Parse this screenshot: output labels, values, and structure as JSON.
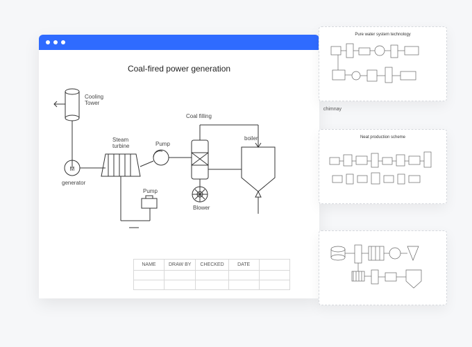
{
  "main": {
    "title": "Coal-fired power generation",
    "labels": {
      "cooling_tower": "Cooling\nTower",
      "steam_turbine": "Steam\nturbine",
      "generator": "generator",
      "generator_icon": "M",
      "pump1": "Pump",
      "pump2": "Pump",
      "blower": "Blower",
      "boiler": "boiler",
      "coal_filling": "Coal filling",
      "chimney": "chimnay"
    },
    "table_headers": [
      "NAME",
      "DRAW BY",
      "CHECKED",
      "DATE",
      ""
    ]
  },
  "thumbnails": [
    {
      "title": "Pure water system technology"
    },
    {
      "title": "Neat production scheme"
    },
    {
      "title": ""
    }
  ]
}
